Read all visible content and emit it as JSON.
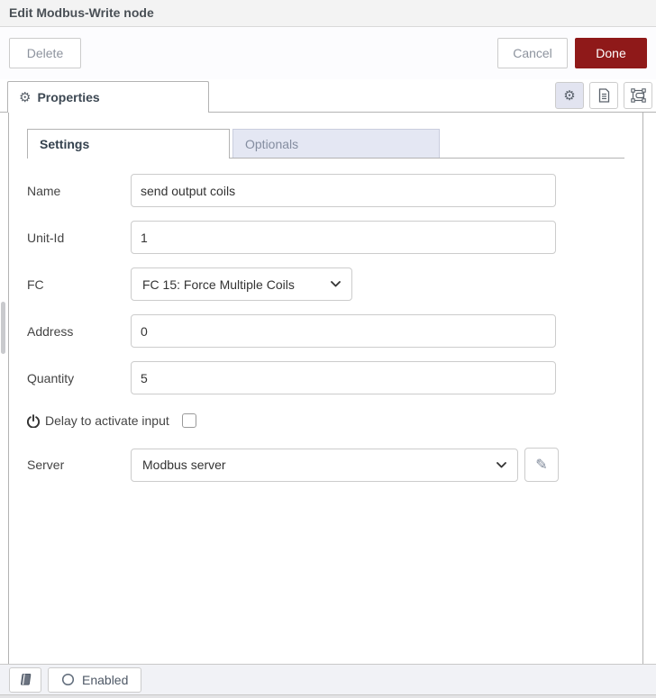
{
  "header": {
    "title": "Edit Modbus-Write node"
  },
  "toolbar": {
    "delete_label": "Delete",
    "cancel_label": "Cancel",
    "done_label": "Done"
  },
  "properties_tab": {
    "label": "Properties",
    "icon": "gear-icon"
  },
  "tray_icon_buttons": [
    {
      "name": "node-properties",
      "icon": "gear-icon",
      "active": true
    },
    {
      "name": "node-description",
      "icon": "document-icon",
      "active": false
    },
    {
      "name": "node-appearance",
      "icon": "appearance-icon",
      "active": false
    }
  ],
  "tabs": {
    "settings": {
      "label": "Settings",
      "active": true
    },
    "optionals": {
      "label": "Optionals",
      "active": false
    }
  },
  "form": {
    "name": {
      "label": "Name",
      "value": "send output coils"
    },
    "unit_id": {
      "label": "Unit-Id",
      "value": "1"
    },
    "fc": {
      "label": "FC",
      "value": "FC 15: Force Multiple Coils"
    },
    "address": {
      "label": "Address",
      "value": "0"
    },
    "quantity": {
      "label": "Quantity",
      "value": "5"
    },
    "delay": {
      "label": "Delay to activate input",
      "checked": false,
      "icon": "power-icon"
    },
    "server": {
      "label": "Server",
      "value": "Modbus server",
      "edit_icon": "pencil-icon"
    }
  },
  "footer": {
    "book_icon": "book-icon",
    "enabled_label": "Enabled",
    "enabled_icon": "circle-icon"
  },
  "colors": {
    "done_button_bg": "#8f1919",
    "inactive_tab_bg": "#e4e7f3",
    "header_bg": "#f3f3f3",
    "footer_bg": "#f1f2f6",
    "border": "#b3b3b3"
  }
}
